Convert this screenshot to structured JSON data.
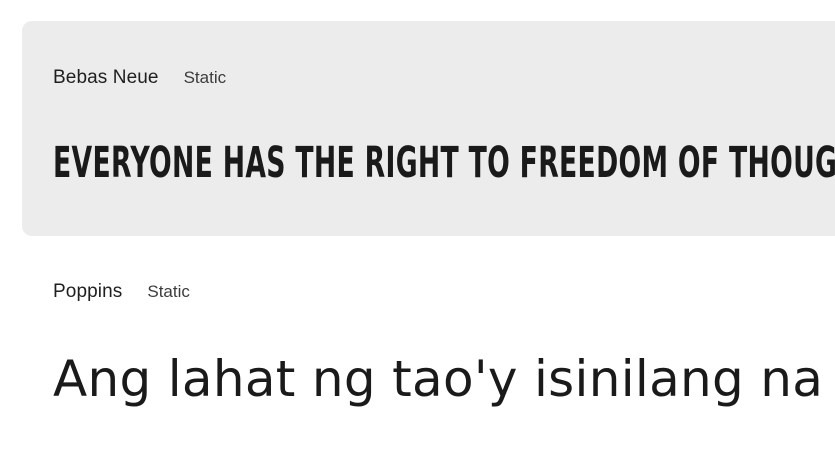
{
  "fonts": [
    {
      "name": "Bebas Neue",
      "type": "Static",
      "sample": "Everyone has the right to freedom of thought,",
      "highlighted": true
    },
    {
      "name": "Poppins",
      "type": "Static",
      "sample": "Ang lahat ng tao'y isinilang na m",
      "highlighted": false
    }
  ],
  "colors": {
    "card_highlight_bg": "#ececec",
    "text": "#1f1f1f",
    "meta_text": "#3c3c3c"
  }
}
